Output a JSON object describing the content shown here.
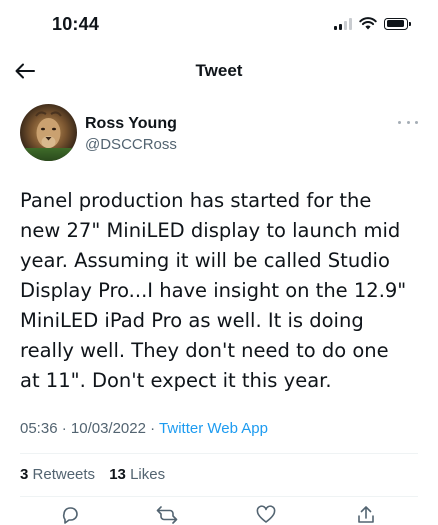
{
  "status_bar": {
    "time": "10:44",
    "icons": [
      "cellular-signal-icon",
      "wifi-icon",
      "battery-icon"
    ]
  },
  "nav": {
    "back_icon": "arrow-left-icon",
    "title": "Tweet"
  },
  "author": {
    "name": "Ross Young",
    "handle": "@DSCCRoss",
    "avatar": "lion-photo-avatar",
    "more_icon": "more-horizontal-icon"
  },
  "tweet": {
    "lines": [
      "Panel production has started for the",
      "new 27\" MiniLED display to launch mid",
      "year. Assuming it will be called Studio",
      "Display Pro...I have insight on the 12.9\"",
      "MiniLED iPad Pro as well. It is doing",
      "really well. They don't need to do one",
      "at 11\". Don't expect it this year."
    ],
    "time": "05:36",
    "separator": "·",
    "date": "10/03/2022",
    "source": "Twitter Web App"
  },
  "stats": {
    "retweets_count": "3",
    "retweets_label": "Retweets",
    "likes_count": "13",
    "likes_label": "Likes"
  },
  "actions": [
    "reply-icon",
    "retweet-icon",
    "like-icon",
    "share-icon"
  ],
  "colors": {
    "accent": "#1d9bf0",
    "text": "#0f1419",
    "secondary": "#536471",
    "divider": "#eff3f4"
  }
}
